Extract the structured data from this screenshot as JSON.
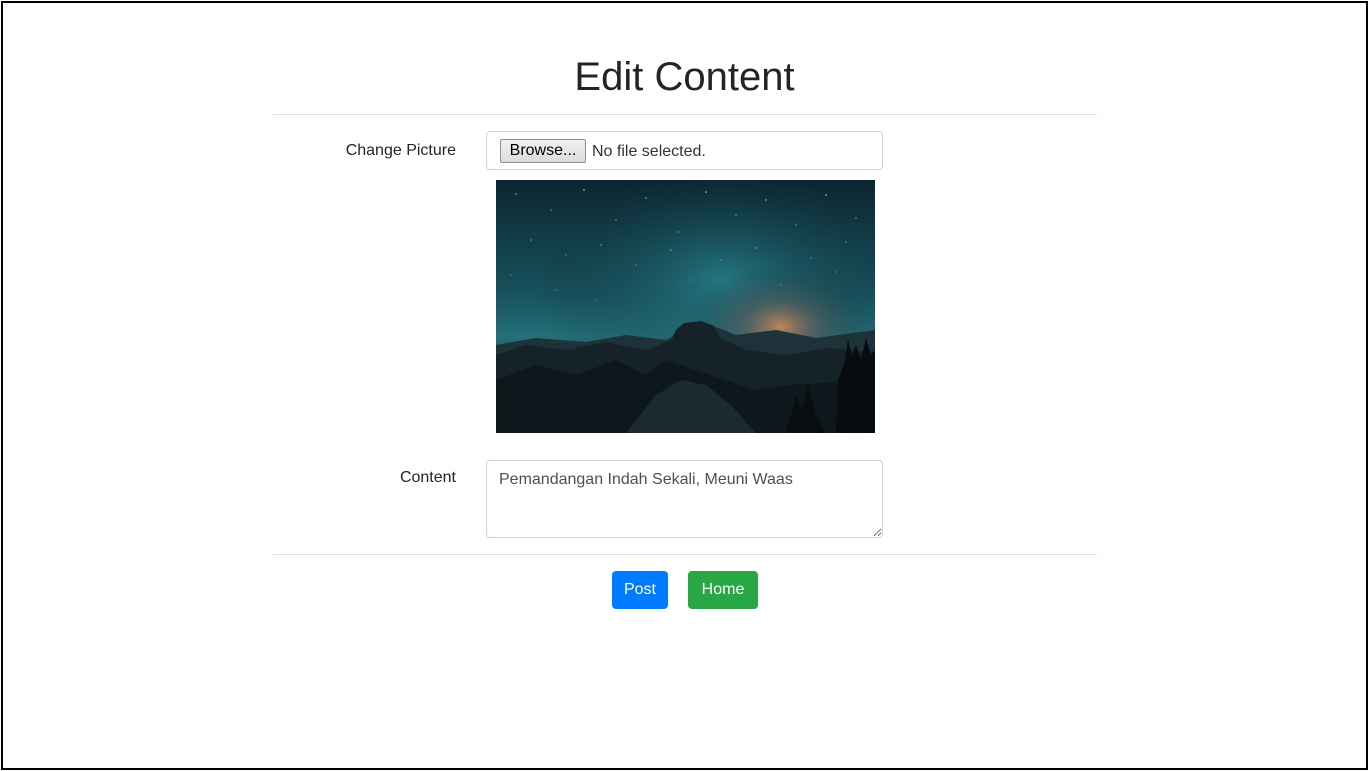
{
  "page": {
    "title": "Edit Content"
  },
  "form": {
    "picture_label": "Change Picture",
    "browse_label": "Browse...",
    "file_status": "No file selected.",
    "content_label": "Content",
    "content_value": "Pemandangan Indah Sekali, Meuni Waas"
  },
  "actions": {
    "post_label": "Post",
    "home_label": "Home"
  },
  "colors": {
    "post_button": "#007bff",
    "home_button": "#28a745"
  }
}
